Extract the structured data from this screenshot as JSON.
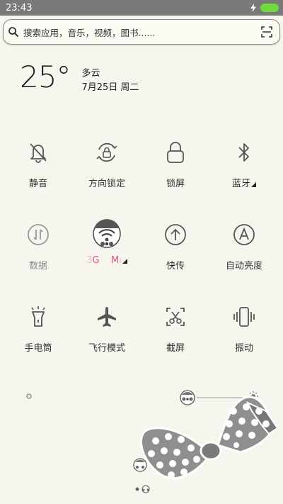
{
  "status_bar": {
    "time": "23:43"
  },
  "search": {
    "placeholder": "搜索应用，音乐，视频，图书......"
  },
  "weather": {
    "temperature": "25°",
    "condition": "多云",
    "date": "7月25日 周二"
  },
  "toggles": [
    {
      "label": "静音",
      "icon": "bell-off-icon"
    },
    {
      "label": "方向锁定",
      "icon": "rotation-lock-icon"
    },
    {
      "label": "锁屏",
      "icon": "lock-icon"
    },
    {
      "label": "蓝牙",
      "icon": "bluetooth-icon"
    },
    {
      "label": "数据",
      "icon": "data-icon"
    },
    {
      "label_a": "G",
      "label_prefix": "3",
      "label_b": "M",
      "icon": "wifi-icon"
    },
    {
      "label": "快传",
      "icon": "upload-icon"
    },
    {
      "label": "自动亮度",
      "icon": "auto-brightness-icon"
    },
    {
      "label": "手电筒",
      "icon": "flashlight-icon"
    },
    {
      "label": "飞行模式",
      "icon": "airplane-icon"
    },
    {
      "label": "截屏",
      "icon": "screenshot-icon"
    },
    {
      "label": "振动",
      "icon": "vibrate-icon"
    }
  ],
  "colors": {
    "background": "#f7f6ee",
    "status_bar": "#7a7a78",
    "battery": "#6ddc3a",
    "accent_pink": "#e0508a"
  }
}
